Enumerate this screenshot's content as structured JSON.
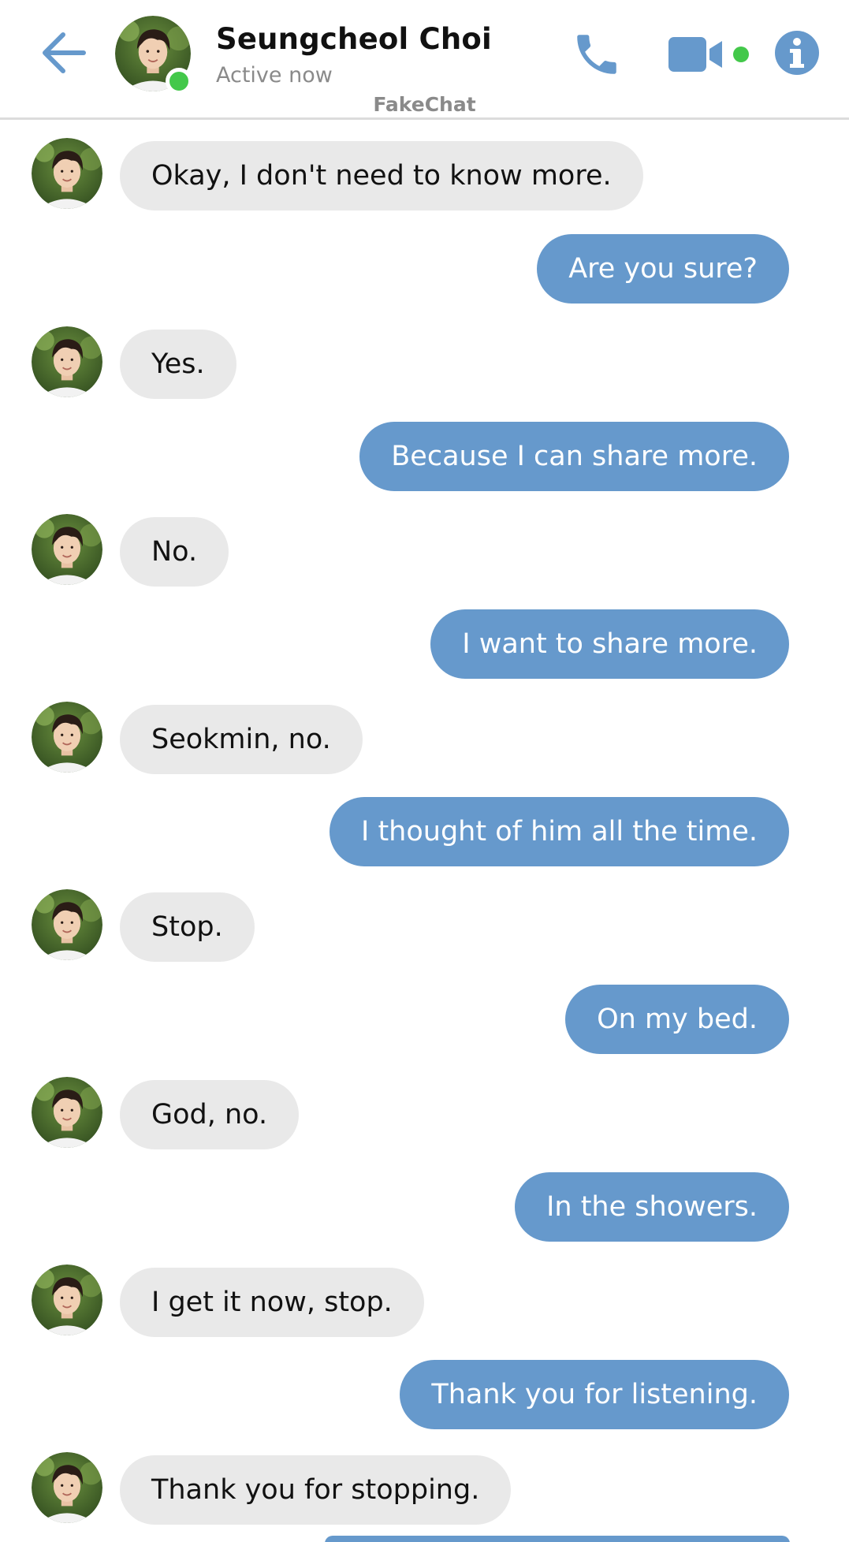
{
  "header": {
    "contact_name": "Seungcheol Choi",
    "status": "Active now",
    "app_label": "FakeChat",
    "icons": [
      "back-arrow-icon",
      "phone-icon",
      "video-camera-icon",
      "info-icon"
    ],
    "accent_color": "#6699cc",
    "online_color": "#43c84a"
  },
  "messages": [
    {
      "sender": "them",
      "text": "Okay, I don't need to know more."
    },
    {
      "sender": "me",
      "text": "Are you sure?"
    },
    {
      "sender": "them",
      "text": "Yes."
    },
    {
      "sender": "me",
      "text": "Because I can share more."
    },
    {
      "sender": "them",
      "text": "No."
    },
    {
      "sender": "me",
      "text": "I want to share more."
    },
    {
      "sender": "them",
      "text": "Seokmin, no."
    },
    {
      "sender": "me",
      "text": "I thought of him all the time."
    },
    {
      "sender": "them",
      "text": "Stop."
    },
    {
      "sender": "me",
      "text": "On my bed."
    },
    {
      "sender": "them",
      "text": "God, no."
    },
    {
      "sender": "me",
      "text": "In the showers."
    },
    {
      "sender": "them",
      "text": "I get it now, stop."
    },
    {
      "sender": "me",
      "text": "Thank you for listening."
    },
    {
      "sender": "them",
      "text": "Thank you for stopping."
    }
  ],
  "colors": {
    "received_bubble": "#e9e9e9",
    "sent_bubble": "#6699cc"
  }
}
